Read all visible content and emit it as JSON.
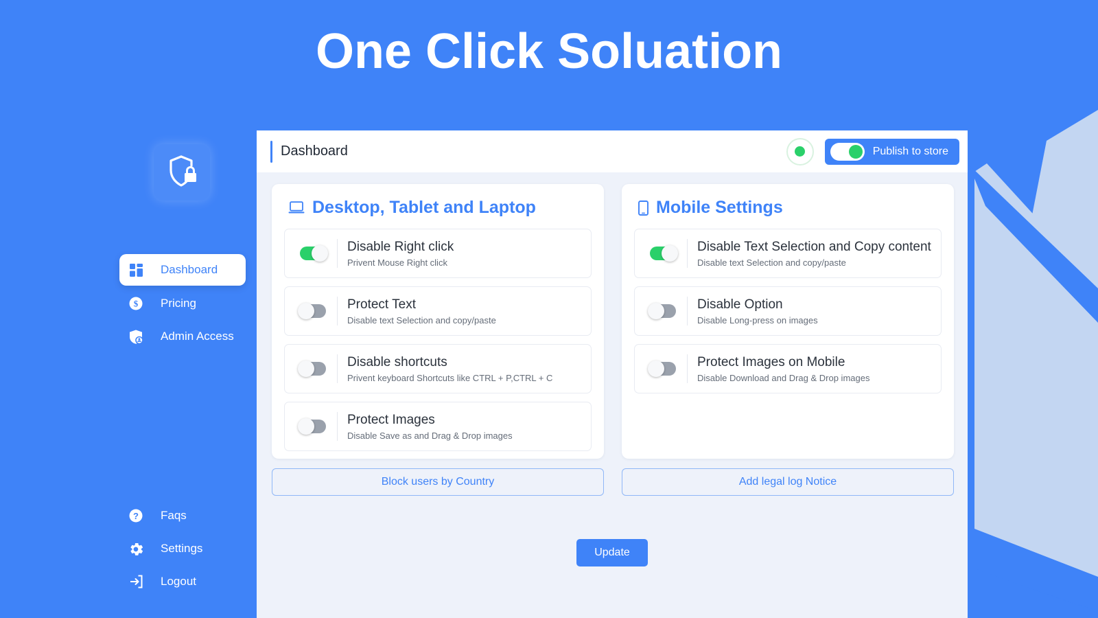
{
  "app": {
    "title": "One Click Soluation",
    "brand_icon": "shield-lock-icon",
    "accent_color": "#3f83f8",
    "green_color": "#2ad06a",
    "panel_bg_color": "#eef2fa"
  },
  "sidebar": {
    "top_items": [
      {
        "label": "Dashboard",
        "icon": "grid-dashboard-icon",
        "active": true
      },
      {
        "label": "Pricing",
        "icon": "dollar-coin-icon",
        "active": false
      },
      {
        "label": "Admin Access",
        "icon": "shield-user-icon",
        "active": false
      }
    ],
    "bottom_items": [
      {
        "label": "Faqs",
        "icon": "question-circle-icon",
        "active": false
      },
      {
        "label": "Settings",
        "icon": "gear-icon",
        "active": false
      },
      {
        "label": "Logout",
        "icon": "logout-arrow-icon",
        "active": false
      }
    ]
  },
  "topbar": {
    "title": "Dashboard",
    "status_indicator": "green-status-dot",
    "publish": {
      "label": "Publish to store",
      "state": "on"
    }
  },
  "desktop_card": {
    "heading": "Desktop, Tablet and Laptop",
    "icon": "laptop-icon",
    "settings": [
      {
        "title": "Disable Right click",
        "subtitle": "Privent Mouse Right click",
        "state": "on"
      },
      {
        "title": "Protect Text",
        "subtitle": "Disable text Selection and copy/paste",
        "state": "off"
      },
      {
        "title": "Disable shortcuts",
        "subtitle": "Privent keyboard Shortcuts like CTRL + P,CTRL + C",
        "state": "off"
      },
      {
        "title": "Protect Images",
        "subtitle": "Disable Save as and Drag & Drop images",
        "state": "off"
      }
    ],
    "action_label": "Block users by Country"
  },
  "mobile_card": {
    "heading": "Mobile Settings",
    "icon": "mobile-phone-icon",
    "settings": [
      {
        "title": "Disable Text Selection and Copy content",
        "subtitle": "Disable text Selection and copy/paste",
        "state": "on"
      },
      {
        "title": "Disable Option",
        "subtitle": "Disable Long-press on images",
        "state": "off"
      },
      {
        "title": "Protect Images on Mobile",
        "subtitle": "Disable Download and Drag & Drop images",
        "state": "off"
      }
    ],
    "action_label": "Add legal log Notice"
  },
  "footer": {
    "update_label": "Update"
  }
}
